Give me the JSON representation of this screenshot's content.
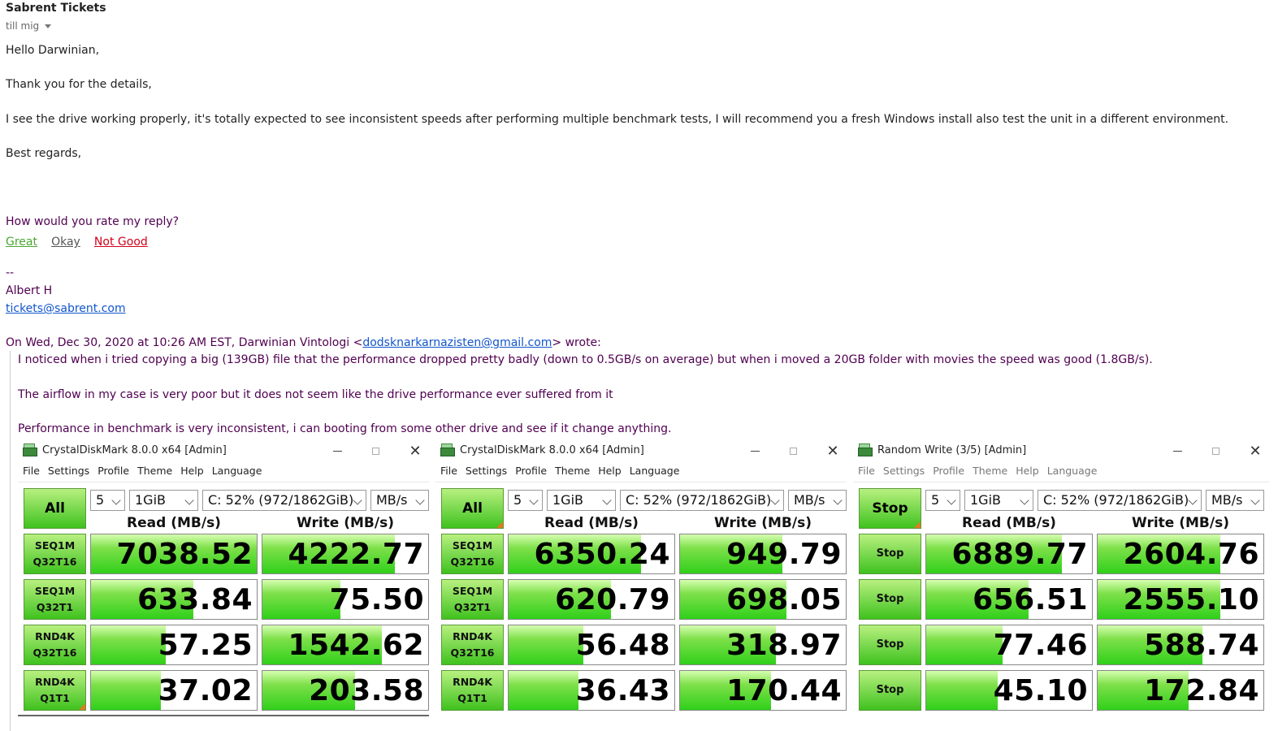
{
  "email": {
    "sender": "Sabrent Tickets",
    "to": "till mig",
    "greeting": "Hello Darwinian,",
    "line1": "Thank you for the details,",
    "line2": "I see the drive working properly, it's totally expected to see inconsistent speeds after performing multiple benchmark tests, I will recommend you a fresh Windows install also test the unit in a different environment.",
    "closing": "Best regards,",
    "rate_question": "How would you rate my reply?",
    "rate_great": "Great",
    "rate_okay": "Okay",
    "rate_not_good": "Not Good",
    "sig_dash": "--",
    "sig_name": "Albert H",
    "sig_email": "tickets@sabrent.com",
    "quote_header_pre": "On Wed, Dec 30, 2020 at 10:26 AM EST, Darwinian Vintologi <",
    "quote_header_email": "dodsknarkarnazisten@gmail.com",
    "quote_header_post": "> wrote:",
    "quote1": "I noticed when i tried copying a big (139GB) file that the performance dropped pretty badly (down to 0.5GB/s on average) but when i moved a 20GB folder with movies the speed was good (1.8GB/s).",
    "quote2": "The airflow in my case is very poor but it does not seem like the drive performance ever suffered from it",
    "quote3": "Performance in benchmark is very inconsistent, i can booting from some other drive and see if it change anything."
  },
  "menu": [
    "File",
    "Settings",
    "Profile",
    "Theme",
    "Help",
    "Language"
  ],
  "windows": [
    {
      "title": "CrystalDiskMark 8.0.0 x64 [Admin]",
      "all_label": "All",
      "count": "5",
      "size": "1GiB",
      "drive": "C: 52% (972/1862GiB)",
      "unit": "MB/s",
      "read_header": "Read (MB/s)",
      "write_header": "Write (MB/s)",
      "rows": [
        {
          "l1": "SEQ1M",
          "l2": "Q32T16",
          "read": "7038.52",
          "write": "4222.77",
          "rf": 1.0,
          "wf": 0.8
        },
        {
          "l1": "SEQ1M",
          "l2": "Q32T1",
          "read": "633.84",
          "write": "75.50",
          "rf": 0.62,
          "wf": 0.47
        },
        {
          "l1": "RND4K",
          "l2": "Q32T16",
          "read": "57.25",
          "write": "1542.62",
          "rf": 0.45,
          "wf": 0.72
        },
        {
          "l1": "RND4K",
          "l2": "Q1T1",
          "read": "37.02",
          "write": "203.58",
          "rf": 0.42,
          "wf": 0.56
        }
      ]
    },
    {
      "title": "CrystalDiskMark 8.0.0 x64 [Admin]",
      "all_label": "All",
      "count": "5",
      "size": "1GiB",
      "drive": "C: 52% (972/1862GiB)",
      "unit": "MB/s",
      "read_header": "Read (MB/s)",
      "write_header": "Write (MB/s)",
      "rows": [
        {
          "l1": "SEQ1M",
          "l2": "Q32T16",
          "read": "6350.24",
          "write": "949.79",
          "rf": 0.8,
          "wf": 0.62
        },
        {
          "l1": "SEQ1M",
          "l2": "Q32T1",
          "read": "620.79",
          "write": "698.05",
          "rf": 0.62,
          "wf": 0.64
        },
        {
          "l1": "RND4K",
          "l2": "Q32T16",
          "read": "56.48",
          "write": "318.97",
          "rf": 0.45,
          "wf": 0.58
        },
        {
          "l1": "RND4K",
          "l2": "Q1T1",
          "read": "36.43",
          "write": "170.44",
          "rf": 0.42,
          "wf": 0.55
        }
      ]
    },
    {
      "title": "Random Write (3/5) [Admin]",
      "all_label": "Stop",
      "count": "5",
      "size": "1GiB",
      "drive": "C: 52% (972/1862GiB)",
      "unit": "MB/s",
      "read_header": "Read (MB/s)",
      "write_header": "Write (MB/s)",
      "rows": [
        {
          "l1": "Stop",
          "l2": "",
          "read": "6889.77",
          "write": "2604.76",
          "rf": 0.82,
          "wf": 0.74
        },
        {
          "l1": "Stop",
          "l2": "",
          "read": "656.51",
          "write": "2555.10",
          "rf": 0.62,
          "wf": 0.74
        },
        {
          "l1": "Stop",
          "l2": "",
          "read": "77.46",
          "write": "588.74",
          "rf": 0.46,
          "wf": 0.63
        },
        {
          "l1": "Stop",
          "l2": "",
          "read": "45.10",
          "write": "172.84",
          "rf": 0.43,
          "wf": 0.55
        }
      ]
    }
  ]
}
